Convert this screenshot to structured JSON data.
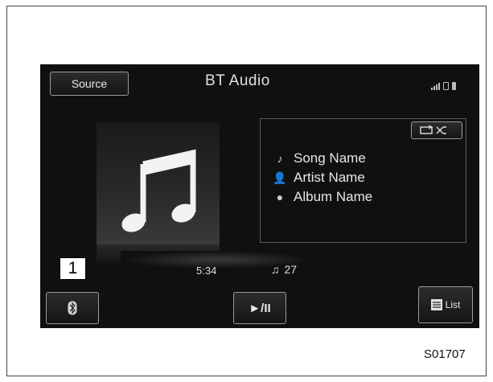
{
  "screen": {
    "source_button": "Source",
    "title": "BT Audio",
    "track": {
      "song": "Song Name",
      "artist": "Artist Name",
      "album": "Album Name"
    },
    "time": "5:34",
    "track_number": "27",
    "play_pause_label": "►/II",
    "list_label": "List"
  },
  "callout": "1",
  "caption": "S01707",
  "colors": {
    "screen_bg": "#101010",
    "text": "#e6e6e6",
    "border": "#9a9a9a"
  },
  "icons": [
    "signal-icon",
    "phone-icon",
    "battery-icon",
    "music-note-icon",
    "person-icon",
    "disc-icon",
    "repeat-icon",
    "shuffle-icon",
    "bluetooth-icon",
    "list-icon"
  ]
}
